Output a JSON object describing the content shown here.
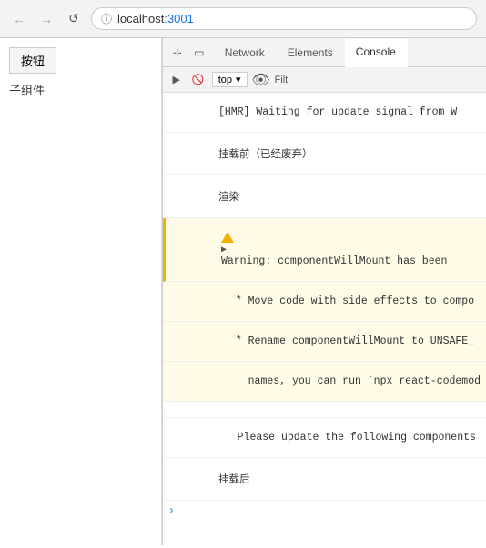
{
  "browser": {
    "url_prefix": "localhost",
    "url_port": ":3001",
    "back_btn": "←",
    "forward_btn": "→",
    "reload_btn": "↺"
  },
  "page": {
    "button_label": "按钮",
    "child_label": "子组件"
  },
  "devtools": {
    "tabs": [
      {
        "label": "Network",
        "active": false
      },
      {
        "label": "Elements",
        "active": false
      },
      {
        "label": "Console",
        "active": true
      }
    ],
    "console_context": "top",
    "filter_label": "Filt",
    "console_lines": [
      {
        "type": "normal",
        "text": "[HMR] Waiting for update signal from W"
      },
      {
        "type": "normal",
        "text": "挂载前（已经废弃）",
        "chinese": true
      },
      {
        "type": "normal",
        "text": "渲染",
        "chinese": true
      },
      {
        "type": "warning",
        "text": "Warning: componentWillMount has been"
      },
      {
        "type": "warning-detail",
        "text": " * Move code with side effects to compo"
      },
      {
        "type": "warning-detail",
        "text": " * Rename componentWillMount to UNSAFE_"
      },
      {
        "type": "warning-detail",
        "text": "   names, you can run `npx react-codemod"
      },
      {
        "type": "normal",
        "text": ""
      },
      {
        "type": "normal",
        "text": "   Please update the following components"
      },
      {
        "type": "normal",
        "text": "挂载后",
        "chinese": true
      }
    ]
  }
}
